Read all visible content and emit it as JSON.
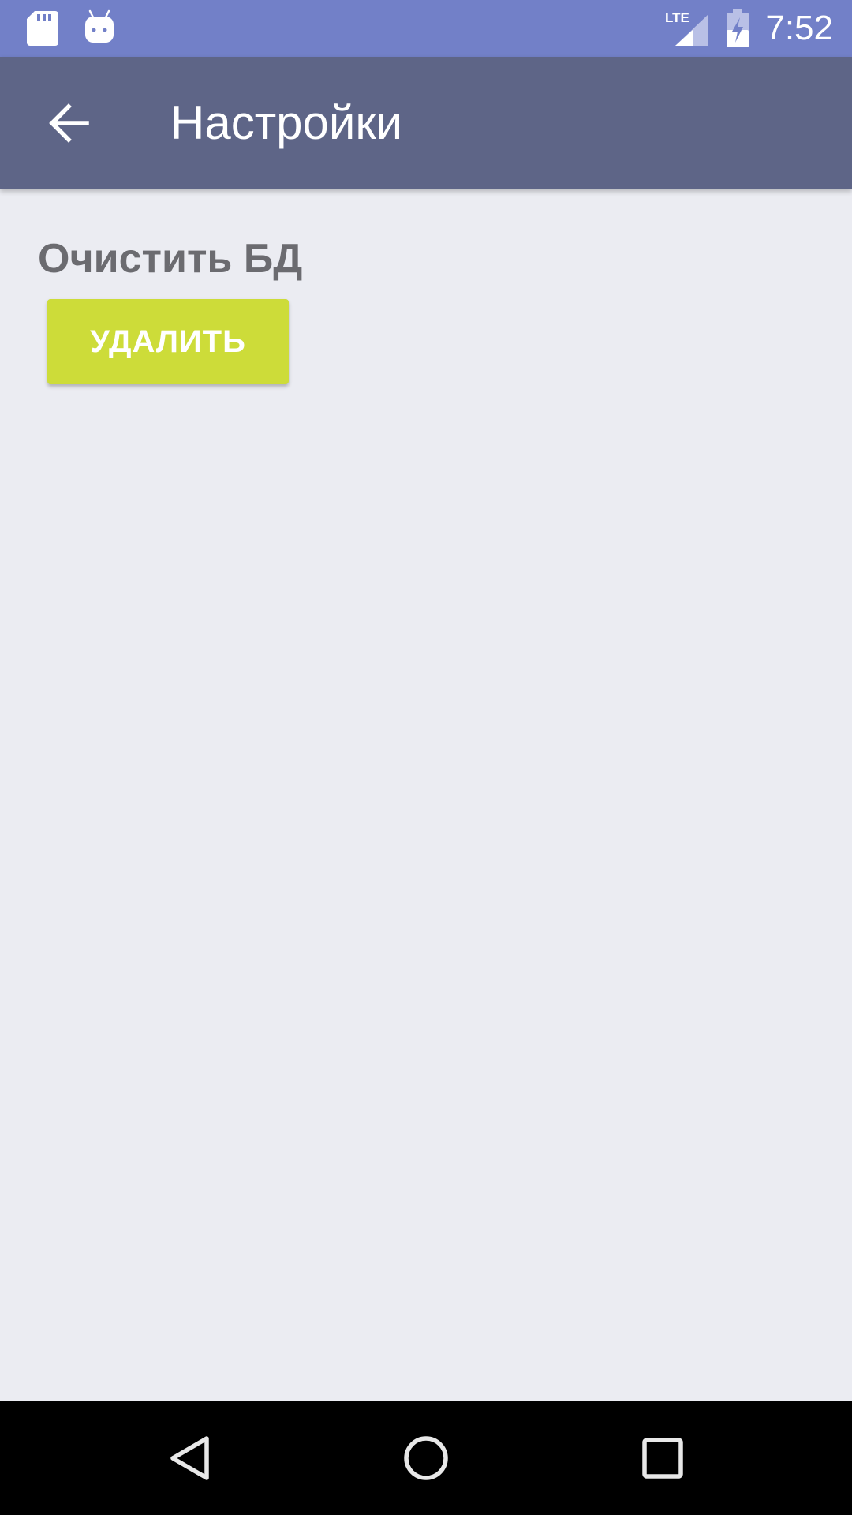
{
  "status_bar": {
    "time": "7:52",
    "network_label": "LTE",
    "icons": [
      "sd-card-icon",
      "android-icon",
      "lte-signal-icon",
      "battery-charging-icon"
    ]
  },
  "app_bar": {
    "title": "Настройки",
    "back_icon": "arrow-back-icon"
  },
  "settings": {
    "section_label": "Очистить БД",
    "delete_button_label": "УДАЛИТЬ"
  },
  "nav_bar": {
    "icons": [
      "nav-back-icon",
      "nav-home-icon",
      "nav-recents-icon"
    ]
  },
  "colors": {
    "status_bar": "#7280c8",
    "app_bar": "#5e6587",
    "background": "#ebecf2",
    "accent_button": "#cddc39",
    "label_text": "#6b6b70",
    "nav_bar": "#000000"
  }
}
